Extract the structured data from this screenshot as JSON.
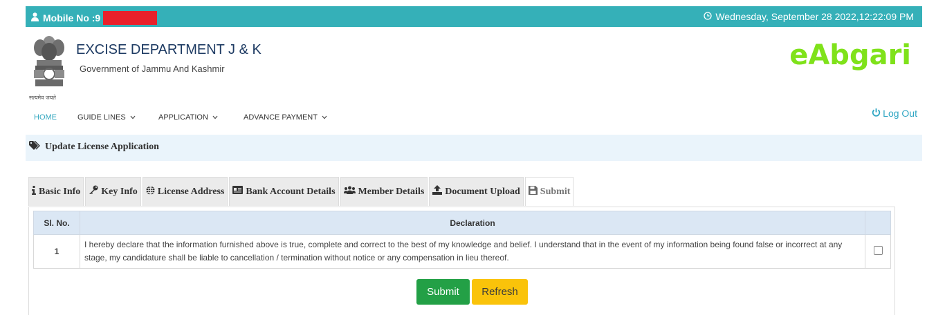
{
  "topbar": {
    "mobile_label": "Mobile No :9",
    "datetime": "Wednesday, September 28 2022,12:22:09 PM"
  },
  "header": {
    "title": "EXCISE DEPARTMENT J & K",
    "subtitle": "Government of Jammu And Kashmir",
    "emblem_motto": "सत्यमेव जयते",
    "brand": "eAbgari"
  },
  "nav": {
    "items": [
      {
        "label": "HOME"
      },
      {
        "label": "GUIDE LINES"
      },
      {
        "label": "APPLICATION"
      },
      {
        "label": "ADVANCE PAYMENT"
      }
    ],
    "logout": "Log Out"
  },
  "breadcrumb": "Update License Application",
  "tabs": [
    {
      "label": "Basic Info",
      "icon": "info-icon"
    },
    {
      "label": "Key Info",
      "icon": "key-icon"
    },
    {
      "label": "License Address",
      "icon": "globe-icon"
    },
    {
      "label": "Bank Account Details",
      "icon": "card-icon"
    },
    {
      "label": "Member Details",
      "icon": "users-icon"
    },
    {
      "label": "Document Upload",
      "icon": "upload-icon"
    },
    {
      "label": "Submit",
      "icon": "save-icon",
      "active": true
    }
  ],
  "table": {
    "headers": [
      "Sl. No.",
      "Declaration",
      ""
    ],
    "rows": [
      {
        "sl": "1",
        "declaration": "I hereby declare that the information furnished above is true, complete and correct to the best of my knowledge and belief. I understand that in the event of my information being found false or incorrect at any stage, my candidature shall be liable to cancellation / termination without notice or any compensation in lieu thereof.",
        "checked": false
      }
    ]
  },
  "actions": {
    "submit": "Submit",
    "refresh": "Refresh"
  },
  "colors": {
    "topbar": "#35b0b8",
    "brand": "#7fe21a",
    "submit": "#23a046",
    "refresh": "#fac30a"
  }
}
